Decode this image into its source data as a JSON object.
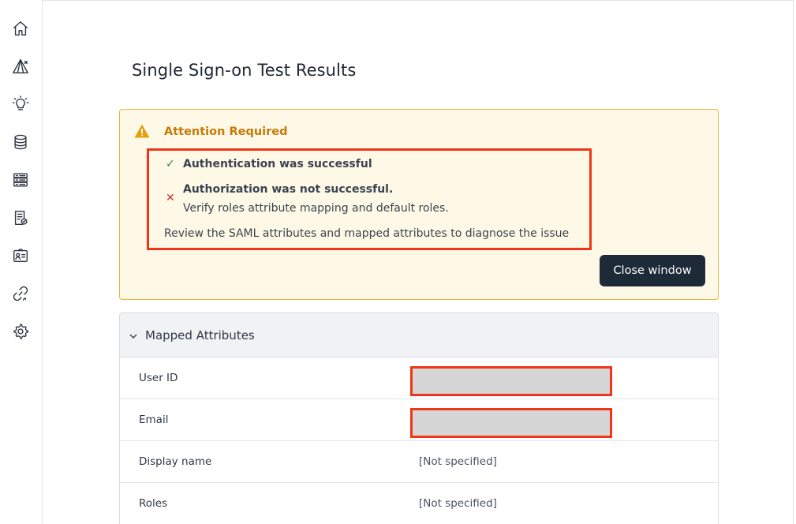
{
  "sidebar": {
    "items": [
      {
        "name": "home-icon"
      },
      {
        "name": "alert-network-icon"
      },
      {
        "name": "lightbulb-icon"
      },
      {
        "name": "database-icon"
      },
      {
        "name": "server-icon"
      },
      {
        "name": "report-icon"
      },
      {
        "name": "contact-card-icon"
      },
      {
        "name": "link-icon"
      },
      {
        "name": "gear-icon"
      }
    ]
  },
  "page": {
    "title": "Single Sign-on Test Results"
  },
  "alert": {
    "title": "Attention Required",
    "success_message": "Authentication was successful",
    "fail_message": "Authorization was not successful.",
    "fail_detail": "Verify roles attribute mapping and default roles.",
    "review_message": "Review the SAML attributes and mapped attributes to diagnose the issue",
    "close_label": "Close window",
    "success_symbol": "✓",
    "fail_symbol": "✕",
    "accent_color": "#c67a0a",
    "highlight_color": "#f03518"
  },
  "mapped_attributes": {
    "title": "Mapped Attributes",
    "rows": [
      {
        "label": "User ID",
        "value": ""
      },
      {
        "label": "Email",
        "value": ""
      },
      {
        "label": "Display name",
        "value": "[Not specified]"
      },
      {
        "label": "Roles",
        "value": "[Not specified]"
      }
    ]
  }
}
